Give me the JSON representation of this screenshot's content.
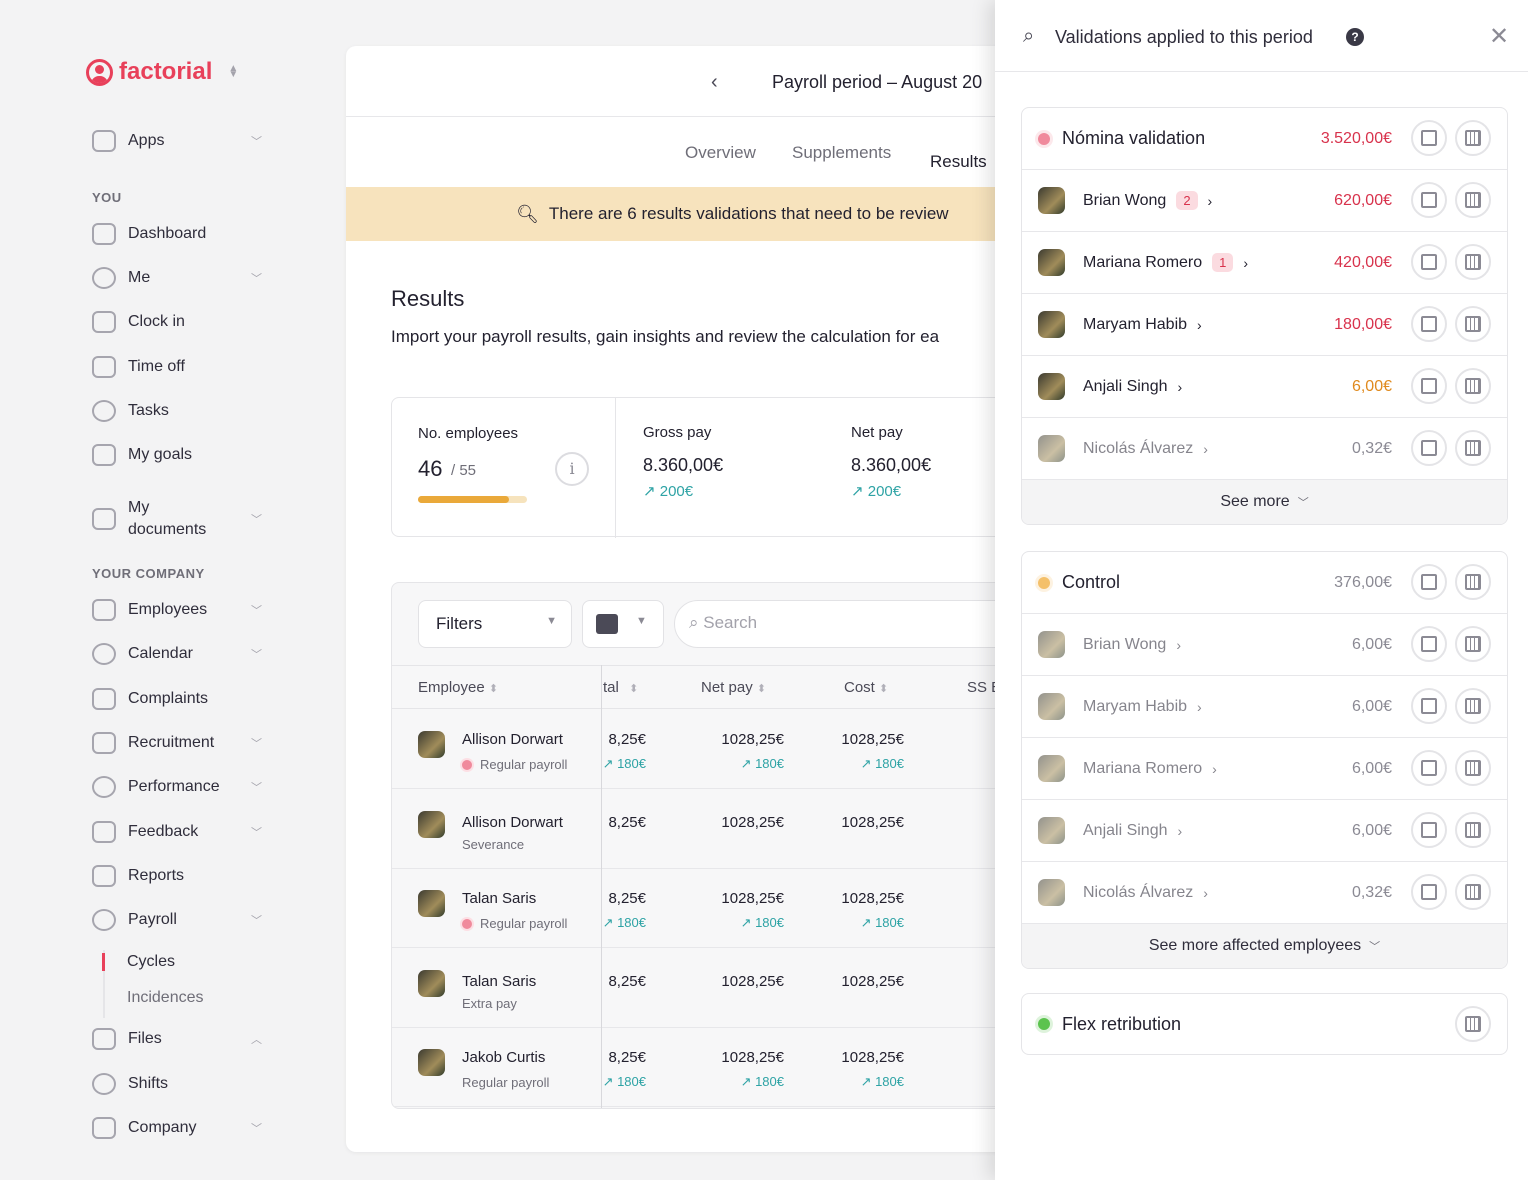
{
  "brand": {
    "name": "factorial"
  },
  "sidebar": {
    "apps": "Apps",
    "section_you": "YOU",
    "section_company": "YOUR COMPANY",
    "you_items": [
      {
        "label": "Dashboard"
      },
      {
        "label": "Me",
        "chev": true
      },
      {
        "label": "Clock in"
      },
      {
        "label": "Time off"
      },
      {
        "label": "Tasks"
      },
      {
        "label": "My goals"
      },
      {
        "label": "My documents",
        "chev": true
      }
    ],
    "company_items": [
      {
        "label": "Employees",
        "chev": true
      },
      {
        "label": "Calendar",
        "chev": true
      },
      {
        "label": "Complaints"
      },
      {
        "label": "Recruitment",
        "chev": true
      },
      {
        "label": "Performance",
        "chev": true
      },
      {
        "label": "Feedback",
        "chev": true
      },
      {
        "label": "Reports"
      },
      {
        "label": "Payroll",
        "chev": true
      }
    ],
    "payroll_sub": [
      {
        "label": "Cycles",
        "active": true
      },
      {
        "label": "Incidences"
      }
    ],
    "bottom_items": [
      {
        "label": "Files",
        "chev": "up"
      },
      {
        "label": "Shifts"
      },
      {
        "label": "Company",
        "chev": true
      }
    ]
  },
  "main": {
    "period_title": "Payroll period – August 20",
    "tabs": [
      "Overview",
      "Supplements",
      "Results"
    ],
    "active_tab": "Results",
    "banner": "There are 6 results validations that need to be review",
    "results_title": "Results",
    "results_subtitle": "Import your payroll results, gain insights and review the calculation for ea",
    "stats": {
      "employees_label": "No. employees",
      "employees_value": "46",
      "employees_total": "/ 55",
      "employees_progress": 0.836,
      "gross_label": "Gross pay",
      "gross_value": "8.360,00€",
      "gross_delta": "200€",
      "net_label": "Net pay",
      "net_value": "8.360,00€",
      "net_delta": "200€"
    },
    "table": {
      "filters_label": "Filters",
      "search_placeholder": "Search",
      "columns": [
        "Employee",
        "tal",
        "Net pay",
        "Cost",
        "SS E"
      ],
      "rows": [
        {
          "name": "Allison Dorwart",
          "type": "Regular payroll",
          "flag": true,
          "total": "8,25€",
          "net": "1028,25€",
          "cost": "1028,25€",
          "delta": "180€"
        },
        {
          "name": "Allison Dorwart",
          "type": "Severance",
          "flag": false,
          "total": "8,25€",
          "net": "1028,25€",
          "cost": "1028,25€",
          "delta": ""
        },
        {
          "name": "Talan Saris",
          "type": "Regular payroll",
          "flag": true,
          "total": "8,25€",
          "net": "1028,25€",
          "cost": "1028,25€",
          "delta": "180€"
        },
        {
          "name": "Talan Saris",
          "type": "Extra pay",
          "flag": false,
          "total": "8,25€",
          "net": "1028,25€",
          "cost": "1028,25€",
          "delta": ""
        },
        {
          "name": "Jakob Curtis",
          "type": "Regular payroll",
          "flag": false,
          "total": "8,25€",
          "net": "1028,25€",
          "cost": "1028,25€",
          "delta": "180€"
        }
      ]
    }
  },
  "drawer": {
    "title": "Validations applied to this period",
    "groups": [
      {
        "title": "Nómina validation",
        "dot": "#f08a9c",
        "amount": "3.520,00€",
        "amount_color": "#d8324c",
        "archive": true,
        "rows": [
          {
            "name": "Brian Wong",
            "badge": "2",
            "amount": "620,00€",
            "color": "#d8324c"
          },
          {
            "name": "Mariana Romero",
            "badge": "1",
            "amount": "420,00€",
            "color": "#d8324c"
          },
          {
            "name": "Maryam Habib",
            "amount": "180,00€",
            "color": "#d8324c"
          },
          {
            "name": "Anjali Singh",
            "amount": "6,00€",
            "color": "#e08a1e"
          },
          {
            "name": "Nicolás Álvarez",
            "amount": "0,32€",
            "color": "#8b8a94",
            "faded": true
          }
        ],
        "see_more": "See more"
      },
      {
        "title": "Control",
        "dot": "#f4c06a",
        "amount": "376,00€",
        "amount_color": "#8b8a94",
        "archive": true,
        "rows": [
          {
            "name": "Brian Wong",
            "amount": "6,00€",
            "faded": true
          },
          {
            "name": "Maryam Habib",
            "amount": "6,00€",
            "faded": true
          },
          {
            "name": "Mariana Romero",
            "amount": "6,00€",
            "faded": true
          },
          {
            "name": "Anjali Singh",
            "amount": "6,00€",
            "faded": true
          },
          {
            "name": "Nicolás Álvarez",
            "amount": "0,32€",
            "faded": true
          }
        ],
        "see_more": "See more affected employees"
      },
      {
        "title": "Flex retribution",
        "dot": "#5cc34e",
        "amount": "",
        "archive": false,
        "rows": []
      }
    ]
  }
}
